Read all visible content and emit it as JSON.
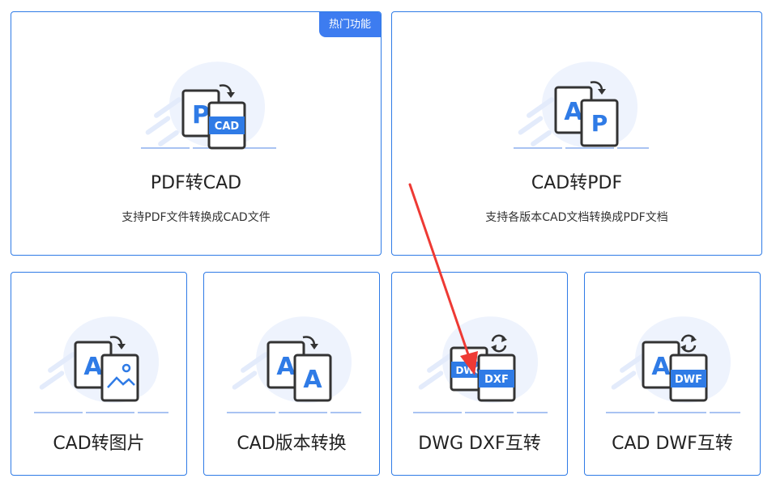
{
  "colors": {
    "accent": "#2f7be6",
    "badge_bg": "#3d7cf0",
    "blob": "#eef3fd",
    "annotation_arrow": "#ee3a34"
  },
  "cards": [
    {
      "id": "pdf-to-cad",
      "title": "PDF转CAD",
      "description": "支持PDF文件转换成CAD文件",
      "badge": "热门功能",
      "icon": "pdf-to-cad-icon",
      "icon_labels": {
        "back": "P",
        "front": "CAD"
      }
    },
    {
      "id": "cad-to-pdf",
      "title": "CAD转PDF",
      "description": "支持各版本CAD文档转换成PDF文档",
      "icon": "cad-to-pdf-icon",
      "icon_labels": {
        "back": "A",
        "front": "P"
      }
    },
    {
      "id": "cad-to-image",
      "title": "CAD转图片",
      "icon": "cad-to-image-icon",
      "icon_labels": {
        "back": "A"
      }
    },
    {
      "id": "cad-version-convert",
      "title": "CAD版本转换",
      "icon": "cad-version-icon",
      "icon_labels": {
        "back": "A",
        "front": "A"
      }
    },
    {
      "id": "dwg-dxf-convert",
      "title": "DWG DXF互转",
      "icon": "dwg-dxf-icon",
      "icon_labels": {
        "back": "DWG",
        "front": "DXF"
      }
    },
    {
      "id": "cad-dwf-convert",
      "title": "CAD DWF互转",
      "icon": "cad-dwf-icon",
      "icon_labels": {
        "back": "A",
        "front": "DWF"
      }
    }
  ]
}
